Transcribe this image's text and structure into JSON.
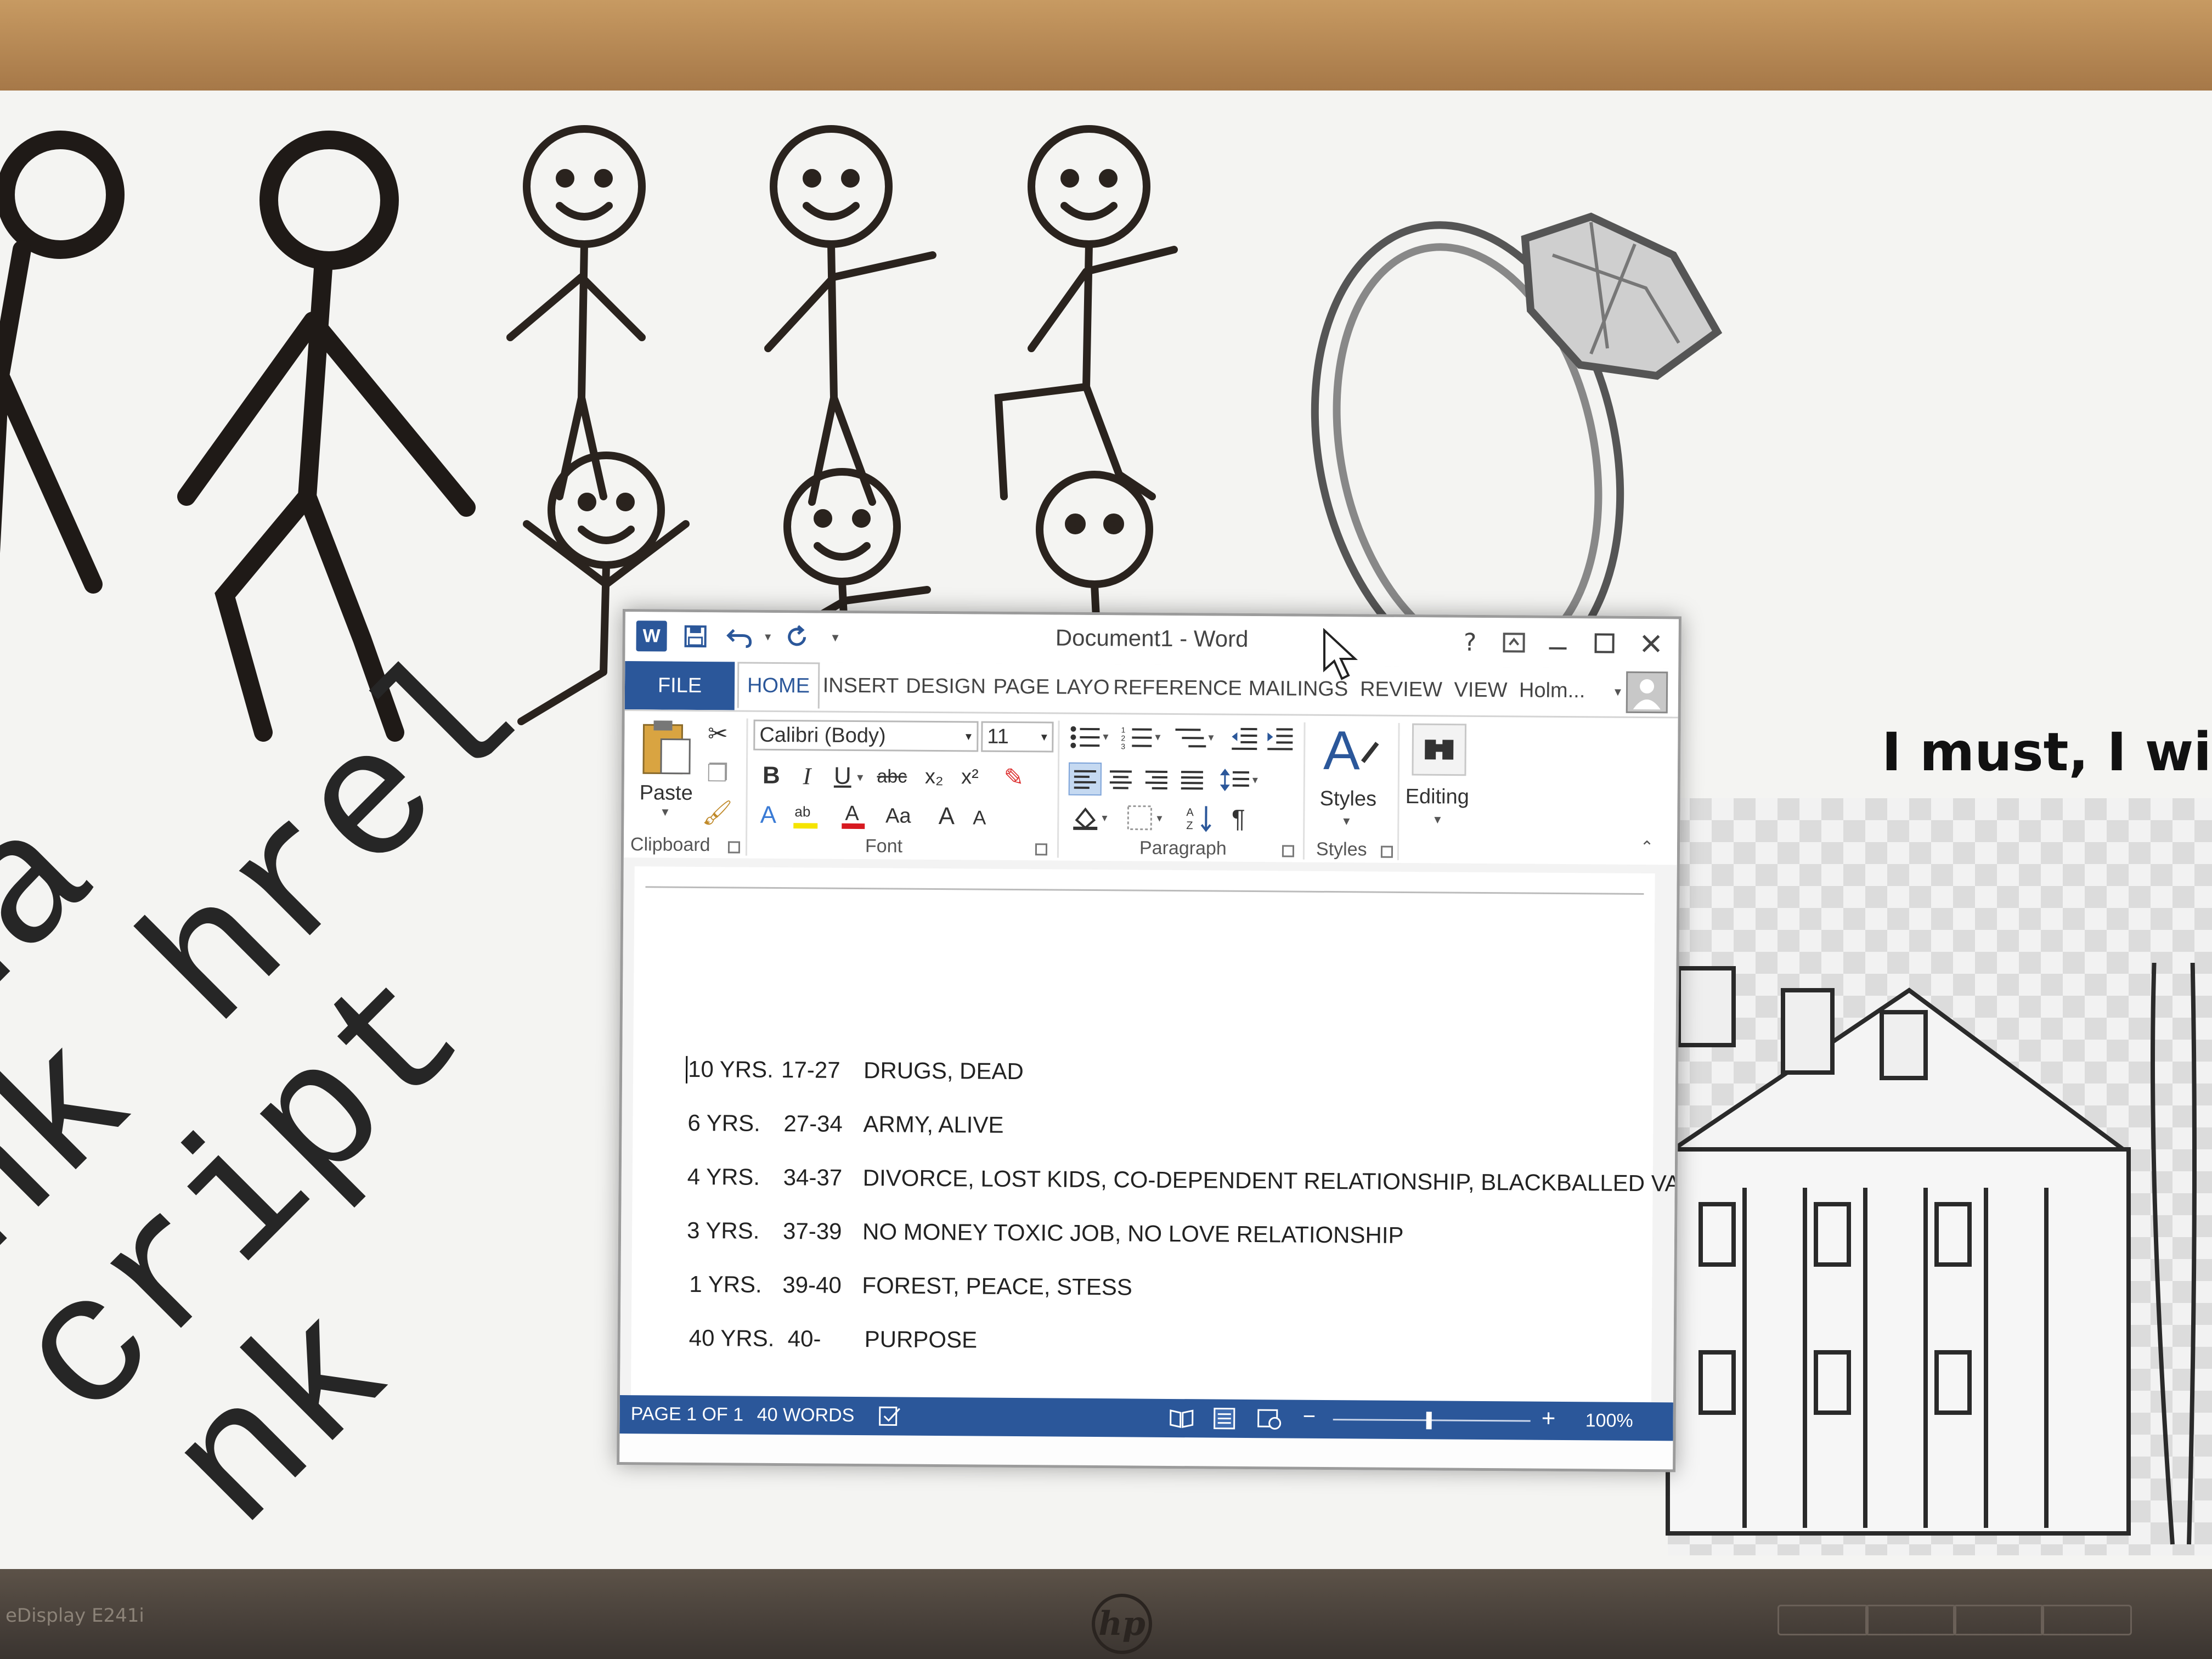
{
  "bezel": {
    "model_text": "eDisplay E241i",
    "brand_logo": "hp"
  },
  "desktop": {
    "motto": "I must, I will",
    "monospace_lines": [
      "a ha",
      "ink hrel",
      "cript",
      "nk"
    ],
    "art_icons": [
      "stick-figures",
      "diamond-ring",
      "mansion-sketch"
    ]
  },
  "word": {
    "title": "Document1 - Word",
    "quick_access": {
      "save_icon": "save-icon",
      "undo_icon": "undo-icon",
      "redo_icon": "redo-icon",
      "customize_icon": "chevron-down-icon"
    },
    "window_buttons": {
      "help": "?",
      "restore_ribbon": "ribbon-display-icon",
      "minimize": "minimize-icon",
      "maximize": "maximize-icon",
      "close": "close-icon"
    },
    "tabs": {
      "file": "FILE",
      "items": [
        "HOME",
        "INSERT",
        "DESIGN",
        "PAGE LAYO",
        "REFERENCE",
        "MAILINGS",
        "REVIEW",
        "VIEW"
      ],
      "active": "HOME",
      "user": "Holm..."
    },
    "ribbon": {
      "clipboard": {
        "paste": "Paste",
        "label": "Clipboard"
      },
      "font": {
        "name": "Calibri (Body)",
        "size": "11",
        "label": "Font",
        "bold": "B",
        "italic": "I",
        "underline": "U",
        "strike": "abc",
        "sub": "x₂",
        "sup": "x²",
        "change_case": "Aa",
        "grow": "A",
        "shrink": "A"
      },
      "paragraph": {
        "label": "Paragraph",
        "pilcrow": "¶"
      },
      "styles": {
        "button": "Styles",
        "label": "Styles"
      },
      "editing": {
        "button": "Editing"
      }
    },
    "document": {
      "rows": [
        {
          "years": "10 YRS.",
          "range": "17-27",
          "notes": "DRUGS, DEAD"
        },
        {
          "years": "6 YRS.",
          "range": "27-34",
          "notes": "ARMY, ALIVE"
        },
        {
          "years": "4 YRS.",
          "range": "34-37",
          "notes": "DIVORCE, LOST KIDS, CO-DEPENDENT RELATIONSHIP, BLACKBALLED VA"
        },
        {
          "years": "3 YRS.",
          "range": "37-39",
          "notes": "NO MONEY TOXIC JOB, NO LOVE RELATIONSHIP"
        },
        {
          "years": "1 YRS.",
          "range": "39-40",
          "notes": "FOREST, PEACE, STESS"
        },
        {
          "years": "40 YRS.",
          "range": "40-",
          "notes": "PURPOSE"
        }
      ]
    },
    "status": {
      "page": "PAGE 1 OF 1",
      "words": "40 WORDS",
      "zoom_minus": "−",
      "zoom_plus": "+",
      "zoom": "100%",
      "zoom_fraction": 1.0
    },
    "colors": {
      "accent": "#2b579a"
    }
  }
}
